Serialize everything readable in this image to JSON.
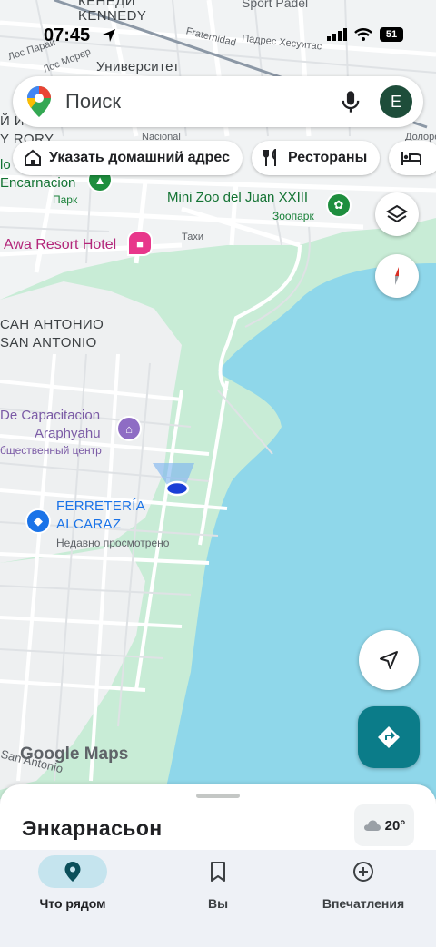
{
  "status": {
    "time": "07:45",
    "battery": "51"
  },
  "search": {
    "placeholder": "Поиск",
    "avatar_letter": "E"
  },
  "chips": [
    {
      "label": "Указать домашний адрес"
    },
    {
      "label": "Рестораны"
    }
  ],
  "map_labels": {
    "kennedy": "KENNEDY",
    "kennedy_cyr": "КЕНЕДИ",
    "sport_padel": "Sport Padel",
    "los_parai": "Лос Парай",
    "los_morer": "Лос Морер",
    "fraternidad": "Fraternidad",
    "padres_hesuitas": "Падрес Хесуитас",
    "universitet": "Университет",
    "nacional": "Nacional",
    "y_rory": "Y RORY",
    "iy": "Й Й",
    "io": "lo",
    "encarnacion": "Encarnacion",
    "park": "Парк",
    "mini_zoo": "Mini Zoo del Juan XXIII",
    "zoopark": "Зоопарк",
    "awa_resort": "Awa Resort Hotel",
    "tahi": "Тахи",
    "san_antonio_cyr": "САН АНТОНИО",
    "san_antonio": "SAN ANTONIO",
    "capacitacion": "De Capacitacion",
    "araphyahu": "Araphyahu",
    "community_center": "бщественный центр",
    "ferreteria": "FERRETERÍA",
    "alcaraz": "ALCARAZ",
    "recently_viewed": "Недавно просмотрено",
    "dolores": "Долоре",
    "san_antonio_corner": "San Antonio",
    "google_maps": "Google Maps"
  },
  "sheet": {
    "place": "Энкарнасьон",
    "temperature": "20°"
  },
  "nav": [
    {
      "label": "Что рядом",
      "active": true
    },
    {
      "label": "Вы",
      "active": false
    },
    {
      "label": "Впечатления",
      "active": false
    }
  ],
  "colors": {
    "water": "#8fd7ea",
    "park": "#c8ecd6",
    "road": "#ffffff",
    "accent": "#0b7c89",
    "location_dot": "#1a3fd6"
  }
}
